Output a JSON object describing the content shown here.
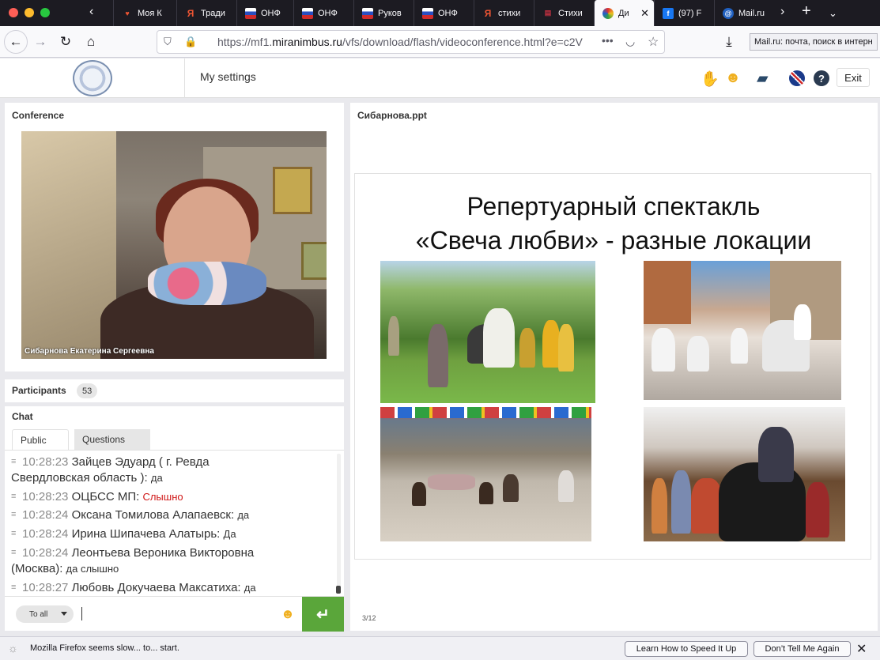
{
  "browser": {
    "tabs": [
      {
        "label": "Моя К",
        "icon": "v-heart"
      },
      {
        "label": "Тради",
        "icon": "yandex"
      },
      {
        "label": "ОНФ",
        "icon": "flag"
      },
      {
        "label": "ОНФ",
        "icon": "flag"
      },
      {
        "label": "Руков",
        "icon": "flag"
      },
      {
        "label": "ОНФ",
        "icon": "flag"
      },
      {
        "label": "стихи",
        "icon": "yandex"
      },
      {
        "label": "Стихи",
        "icon": "book"
      },
      {
        "label": "Ди",
        "icon": "conference"
      },
      {
        "label": "(97) F",
        "icon": "facebook"
      },
      {
        "label": "Mail.ru",
        "icon": "mail"
      }
    ],
    "url": {
      "prefix": "https://mf1.",
      "domain": "miranimbus.ru",
      "path": "/vfs/download/flash/videoconference.html?e=c2V"
    },
    "tooltip": "Mail.ru: почта, поиск в интерн"
  },
  "app": {
    "settings_label": "My settings",
    "exit_label": "Exit"
  },
  "conference": {
    "title": "Conference",
    "speaker_name": "Сибарнова Екатерина Сергеевна"
  },
  "participants": {
    "label": "Participants",
    "count": "53"
  },
  "chat": {
    "title": "Chat",
    "tabs": {
      "public": "Public",
      "questions": "Questions"
    },
    "messages": [
      {
        "time": "",
        "author": "",
        "text": "",
        "partial": true
      },
      {
        "time": "10:28:23",
        "author": "Зайцев Эдуард ( г. Ревда",
        "author2": "Свердловская область ):",
        "text": "да",
        "red": false
      },
      {
        "time": "10:28:23",
        "author": "ОЦБСС МП:",
        "text": "Слышно",
        "red": true
      },
      {
        "time": "10:28:24",
        "author": "Оксана Томилова Алапаевск:",
        "text": "да",
        "red": false
      },
      {
        "time": "10:28:24",
        "author": "Ирина Шипачева Алатырь:",
        "text": "Да",
        "red": false
      },
      {
        "time": "10:28:24",
        "author": "Леонтьева Вероника Викторовна",
        "author2": "(Москва):",
        "text": "да слышно",
        "red": false
      },
      {
        "time": "10:28:27",
        "author": "Любовь Докучаева Максатиха:",
        "text": "да",
        "red": false
      }
    ],
    "recipient": "To all"
  },
  "presentation": {
    "title": "Сибарнова.ppt",
    "slide_title_line1": "Репертуарный спектакль",
    "slide_title_line2": "«Свеча любви» - разные локации",
    "page": "3/12"
  },
  "notification": {
    "message": "Mozilla Firefox seems slow... to... start.",
    "learn_button": "Learn How to Speed It Up",
    "dismiss_button": "Don’t Tell Me Again"
  }
}
